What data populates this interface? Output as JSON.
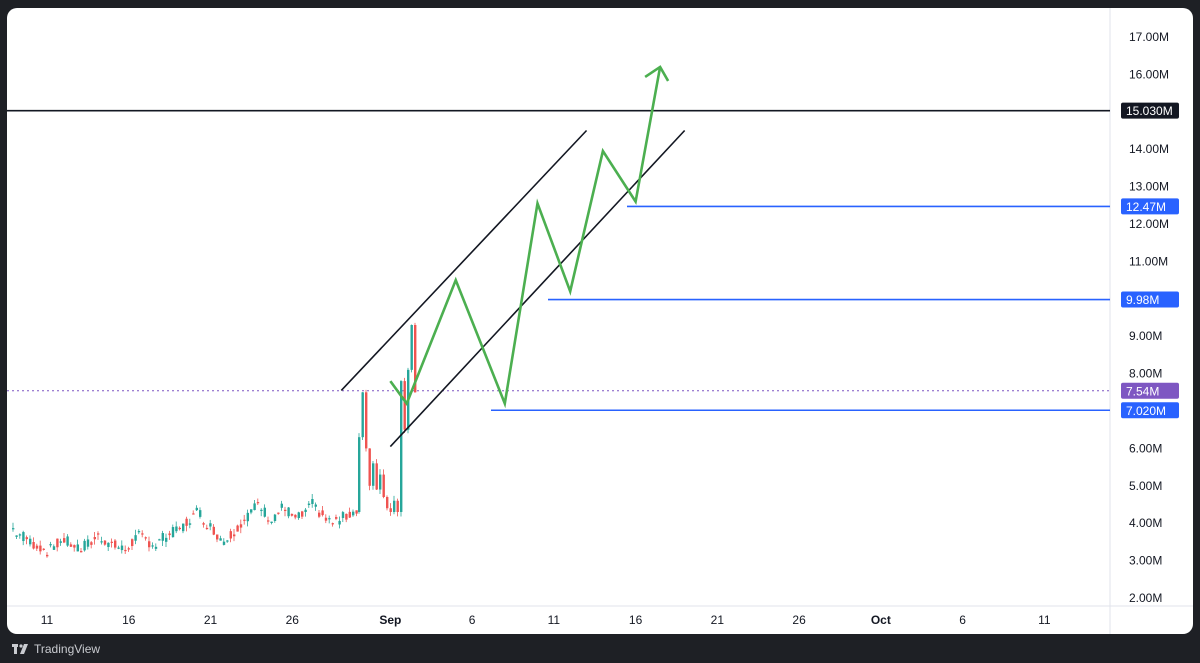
{
  "chart_data": {
    "type": "candlestick",
    "price_axis_labels": [
      "17.00M",
      "16.00M",
      "14.00M",
      "13.00M",
      "12.00M",
      "11.00M",
      "9.00M",
      "8.00M",
      "6.00M",
      "5.00M",
      "4.00M",
      "3.00M",
      "2.00M"
    ],
    "date_axis_labels": [
      "11",
      "16",
      "21",
      "26",
      "Sep",
      "6",
      "11",
      "16",
      "21",
      "26",
      "Oct",
      "6",
      "11"
    ],
    "ylim": [
      2.0,
      17.5
    ],
    "horizontal_levels": [
      {
        "label": "15.030M",
        "value": 15.03,
        "color": "#131722",
        "style": "solid"
      },
      {
        "label": "12.47M",
        "value": 12.47,
        "color": "#2962ff",
        "style": "solid"
      },
      {
        "label": "9.98M",
        "value": 9.98,
        "color": "#2962ff",
        "style": "solid"
      },
      {
        "label": "7.54M",
        "value": 7.54,
        "color": "#7e57c2",
        "style": "dotted"
      },
      {
        "label": "7.020M",
        "value": 7.02,
        "color": "#2962ff",
        "style": "solid"
      }
    ],
    "colors": {
      "up": "#26a69a",
      "down": "#ef5350",
      "projection": "#4caf50",
      "channel": "#131722"
    },
    "channel": {
      "upper": [
        [
          "Aug 29",
          7.55
        ],
        [
          "Sep 13",
          14.5
        ]
      ],
      "lower": [
        [
          "Sep 1",
          6.05
        ],
        [
          "Sep 19",
          14.5
        ]
      ]
    },
    "projection_path": [
      [
        "Sep 1",
        7.8
      ],
      [
        "Sep 2",
        7.2
      ],
      [
        "Sep 5",
        10.5
      ],
      [
        "Sep 8",
        7.2
      ],
      [
        "Sep 10",
        12.55
      ],
      [
        "Sep 12",
        10.2
      ],
      [
        "Sep 14",
        13.95
      ],
      [
        "Sep 16",
        12.6
      ],
      [
        "Sep 17.5",
        16.2
      ]
    ],
    "grid": false,
    "legend": "none"
  },
  "footer": {
    "brand": "TradingView"
  }
}
